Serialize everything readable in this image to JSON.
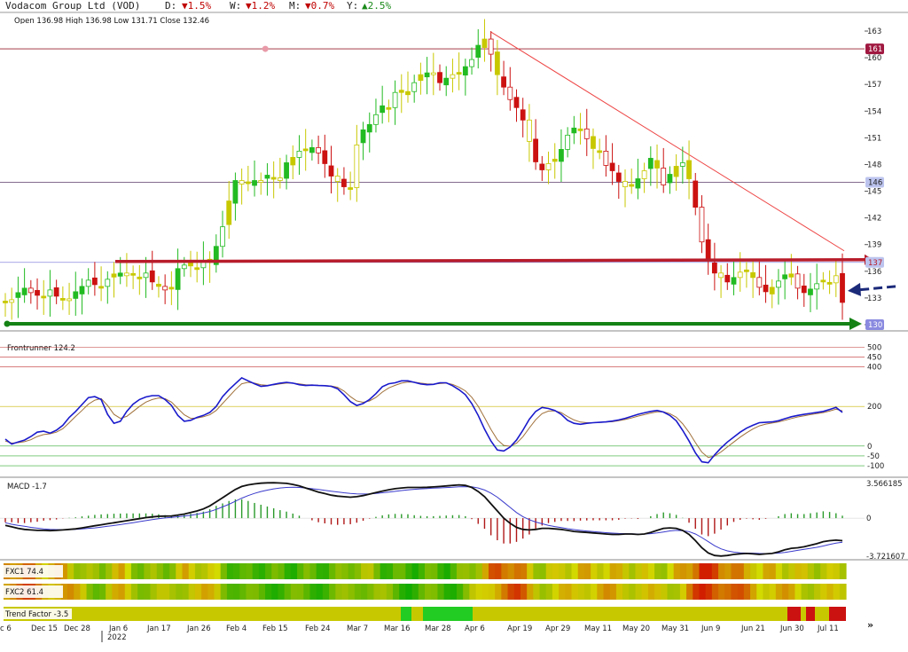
{
  "header": {
    "title": "Vodacom Group Ltd (VOD)",
    "d_label": "D:",
    "d_value": "▼1.5%",
    "w_label": "W:",
    "w_value": "▼1.2%",
    "m_label": "M:",
    "m_value": "▼0.7%",
    "y_label": "Y:",
    "y_value": "▲2.5%",
    "ohlc": "Open 136.98  High 136.98  Low 131.71  Close 132.46"
  },
  "price_axis": {
    "ticks": [
      "163",
      "160",
      "157",
      "154",
      "151",
      "148",
      "145",
      "142",
      "139",
      "136",
      "133",
      "130"
    ],
    "badges": {
      "top": "161",
      "mid": "146",
      "support": "137",
      "low": "130"
    }
  },
  "frontrunner": {
    "label": "Frontrunner 124.2",
    "ticks": [
      "500",
      "450",
      "400",
      "200",
      "0",
      "-50",
      "-100"
    ]
  },
  "macd": {
    "label": "MACD -1.7",
    "ticks": [
      "3.566185",
      "0",
      "-3.721607"
    ]
  },
  "fxc1": {
    "label": "FXC1 74.4"
  },
  "fxc2": {
    "label": "FXC2 61.4"
  },
  "trend": {
    "label": "Trend Factor -3.5"
  },
  "dates": {
    "labels": [
      "c 6",
      "Dec 15",
      "Dec 28",
      "Jan 6",
      "Jan 17",
      "Jan 26",
      "Feb 4",
      "Feb 15",
      "Feb 24",
      "Mar 7",
      "Mar 16",
      "Mar 28",
      "Apr 6",
      "Apr 19",
      "Apr 29",
      "May 11",
      "May 20",
      "May 31",
      "Jun 9",
      "Jun 21",
      "Jun 30",
      "Jul 11"
    ],
    "year": "2022"
  },
  "colors": {
    "up_green": "#22bb22",
    "down_red": "#cc1111",
    "neutral_yellow": "#c8c800",
    "fast_line": "#1a1acc",
    "slow_line": "#a0703a",
    "resistance": "#b81c2a",
    "support_line": "#148214"
  },
  "chart_data": [
    {
      "type": "candlestick",
      "title": "Vodacom Group Ltd (VOD)",
      "ylim": [
        129.4,
        163.6
      ],
      "close": [
        132.5,
        132.8,
        133.6,
        134.1,
        133.6,
        133.3,
        133.2,
        133.9,
        133.2,
        132.9,
        132.7,
        133.7,
        134.3,
        135.0,
        134.5,
        134.3,
        135.1,
        135.7,
        135.8,
        135.5,
        135.6,
        135.3,
        135.8,
        134.8,
        134.3,
        133.9,
        134.2,
        136.3,
        136.7,
        136.6,
        136.4,
        137.1,
        137.0,
        138.8,
        141.0,
        143.9,
        146.2,
        145.8,
        145.9,
        146.2,
        146.2,
        146.8,
        146.5,
        146.2,
        148.2,
        148.8,
        149.5,
        149.6,
        149.9,
        149.3,
        148.1,
        146.7,
        146.1,
        145.5,
        145.4,
        150.2,
        151.9,
        152.5,
        153.6,
        154.6,
        154.4,
        156.1,
        156.1,
        156.2,
        157.2,
        158.1,
        158.3,
        158.1,
        157.2,
        157.7,
        158.1,
        158.3,
        159.0,
        159.8,
        161.4,
        162.1,
        160.4,
        158.1,
        156.7,
        155.3,
        154.4,
        153.0,
        150.6,
        148.3,
        147.4,
        148.1,
        148.6,
        149.7,
        151.3,
        152.1,
        152.0,
        150.9,
        149.8,
        149.5,
        147.9,
        147.3,
        146.1,
        145.5,
        145.6,
        146.4,
        147.3,
        148.7,
        147.6,
        145.7,
        146.9,
        147.8,
        148.2,
        146.4,
        143.2,
        139.3,
        137.2,
        135.8,
        135.3,
        134.8,
        135.3,
        135.9,
        136.1,
        135.3,
        134.2,
        133.7,
        134.2,
        134.9,
        135.6,
        135.7,
        134.1,
        133.6,
        134.0,
        134.6,
        135.0,
        134.7,
        135.5,
        132.5
      ]
    },
    {
      "type": "line",
      "title": "Frontrunner 124.2",
      "ylim": [
        -140,
        560
      ],
      "series": [
        {
          "name": "Frontrunner 124.2",
          "values": [
            35,
            10,
            20,
            30,
            48,
            70,
            75,
            65,
            80,
            105,
            145,
            175,
            210,
            245,
            250,
            235,
            160,
            115,
            125,
            175,
            212,
            235,
            248,
            255,
            255,
            235,
            205,
            155,
            125,
            130,
            145,
            155,
            170,
            200,
            250,
            285,
            315,
            345,
            330,
            315,
            302,
            305,
            312,
            318,
            322,
            318,
            310,
            306,
            308,
            306,
            305,
            302,
            290,
            260,
            225,
            205,
            215,
            235,
            265,
            300,
            315,
            320,
            330,
            330,
            322,
            314,
            310,
            312,
            320,
            320,
            305,
            285,
            260,
            215,
            155,
            85,
            25,
            -20,
            -25,
            -5,
            30,
            80,
            135,
            175,
            195,
            190,
            180,
            160,
            130,
            115,
            110,
            115,
            118,
            120,
            122,
            126,
            132,
            140,
            150,
            160,
            168,
            175,
            180,
            172,
            155,
            128,
            80,
            25,
            -35,
            -80,
            -85,
            -45,
            -10,
            20,
            45,
            70,
            90,
            105,
            118,
            120,
            122,
            128,
            138,
            148,
            155,
            160,
            165,
            170,
            175,
            185,
            195,
            170
          ]
        },
        {
          "name": "",
          "values": [
            25,
            15,
            17,
            22,
            32,
            48,
            58,
            62,
            70,
            88,
            118,
            150,
            180,
            212,
            232,
            240,
            205,
            160,
            140,
            150,
            175,
            200,
            222,
            235,
            243,
            239,
            222,
            190,
            158,
            140,
            142,
            148,
            158,
            180,
            215,
            250,
            285,
            315,
            322,
            318,
            310,
            307,
            309,
            314,
            318,
            318,
            314,
            310,
            309,
            307,
            306,
            304,
            297,
            278,
            250,
            228,
            221,
            228,
            246,
            273,
            294,
            307,
            318,
            324,
            323,
            318,
            314,
            313,
            316,
            318,
            312,
            298,
            279,
            247,
            201,
            143,
            84,
            32,
            3,
            -1,
            14,
            47,
            91,
            133,
            164,
            177,
            178,
            169,
            149,
            132,
            121,
            118,
            118,
            119,
            121,
            123,
            128,
            134,
            142,
            151,
            159,
            167,
            173,
            173,
            164,
            146,
            113,
            69,
            17,
            -31,
            -58,
            -51,
            -30,
            -5,
            20,
            45,
            67,
            86,
            102,
            111,
            116,
            122,
            130,
            139,
            147,
            153,
            159,
            164,
            169,
            177,
            186,
            178
          ]
        }
      ]
    },
    {
      "type": "bar",
      "title": "MACD -1.7",
      "ylim": [
        -3.721607,
        3.566185
      ],
      "series": [
        {
          "name": "MACD -1.7",
          "values": [
            -0.7,
            -0.85,
            -1.0,
            -1.1,
            -1.15,
            -1.2,
            -1.2,
            -1.22,
            -1.2,
            -1.15,
            -1.1,
            -1.05,
            -0.95,
            -0.85,
            -0.75,
            -0.65,
            -0.55,
            -0.45,
            -0.35,
            -0.25,
            -0.15,
            -0.05,
            0.05,
            0.12,
            0.18,
            0.2,
            0.22,
            0.3,
            0.4,
            0.55,
            0.7,
            0.9,
            1.2,
            1.6,
            2.0,
            2.4,
            2.8,
            3.1,
            3.25,
            3.35,
            3.42,
            3.45,
            3.46,
            3.44,
            3.4,
            3.3,
            3.15,
            2.95,
            2.75,
            2.55,
            2.4,
            2.25,
            2.15,
            2.1,
            2.05,
            2.1,
            2.2,
            2.35,
            2.5,
            2.65,
            2.78,
            2.88,
            2.95,
            3.0,
            3.0,
            3.0,
            3.02,
            3.05,
            3.1,
            3.15,
            3.2,
            3.25,
            3.2,
            3.0,
            2.6,
            2.1,
            1.4,
            0.7,
            0.0,
            -0.5,
            -0.9,
            -1.1,
            -1.15,
            -1.1,
            -1.0,
            -1.0,
            -1.05,
            -1.1,
            -1.2,
            -1.3,
            -1.35,
            -1.4,
            -1.45,
            -1.5,
            -1.55,
            -1.6,
            -1.6,
            -1.55,
            -1.55,
            -1.6,
            -1.55,
            -1.4,
            -1.2,
            -1.0,
            -0.95,
            -1.0,
            -1.2,
            -1.6,
            -2.2,
            -2.9,
            -3.4,
            -3.65,
            -3.7,
            -3.65,
            -3.55,
            -3.5,
            -3.45,
            -3.5,
            -3.55,
            -3.5,
            -3.45,
            -3.3,
            -3.1,
            -2.95,
            -2.9,
            -2.8,
            -2.65,
            -2.5,
            -2.3,
            -2.2,
            -2.15,
            -2.2
          ]
        },
        {
          "name": "",
          "values": [
            -0.45,
            -0.6,
            -0.7,
            -0.8,
            -0.9,
            -0.98,
            -1.05,
            -1.1,
            -1.12,
            -1.13,
            -1.12,
            -1.1,
            -1.06,
            -1.0,
            -0.95,
            -0.88,
            -0.8,
            -0.72,
            -0.63,
            -0.54,
            -0.44,
            -0.34,
            -0.24,
            -0.15,
            -0.06,
            0.02,
            0.08,
            0.14,
            0.2,
            0.28,
            0.38,
            0.5,
            0.65,
            0.85,
            1.1,
            1.35,
            1.65,
            1.95,
            2.2,
            2.42,
            2.6,
            2.74,
            2.86,
            2.95,
            3.0,
            3.02,
            3.0,
            2.95,
            2.88,
            2.8,
            2.72,
            2.64,
            2.56,
            2.48,
            2.42,
            2.38,
            2.36,
            2.38,
            2.42,
            2.48,
            2.55,
            2.62,
            2.7,
            2.76,
            2.82,
            2.86,
            2.9,
            2.93,
            2.96,
            2.99,
            3.02,
            3.06,
            3.08,
            3.06,
            2.95,
            2.75,
            2.45,
            2.05,
            1.55,
            1.05,
            0.55,
            0.15,
            -0.15,
            -0.38,
            -0.55,
            -0.7,
            -0.82,
            -0.93,
            -1.03,
            -1.12,
            -1.2,
            -1.26,
            -1.32,
            -1.37,
            -1.42,
            -1.47,
            -1.5,
            -1.52,
            -1.53,
            -1.55,
            -1.55,
            -1.52,
            -1.45,
            -1.35,
            -1.25,
            -1.2,
            -1.22,
            -1.32,
            -1.55,
            -1.9,
            -2.3,
            -2.7,
            -3.0,
            -3.2,
            -3.32,
            -3.4,
            -3.42,
            -3.43,
            -3.45,
            -3.46,
            -3.45,
            -3.42,
            -3.35,
            -3.25,
            -3.15,
            -3.05,
            -2.95,
            -2.85,
            -2.72,
            -2.58,
            -2.45,
            -2.35
          ]
        }
      ]
    }
  ]
}
